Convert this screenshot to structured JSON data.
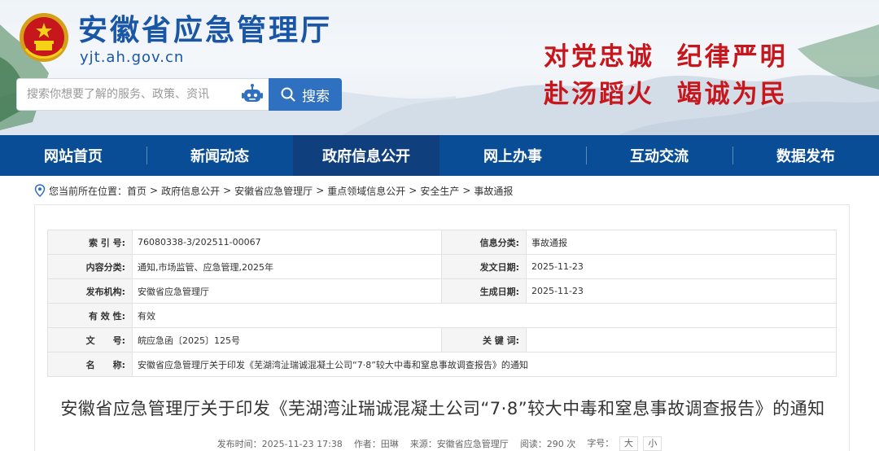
{
  "header": {
    "site_title": "安徽省应急管理厅",
    "site_domain": "yjt.ah.gov.cn",
    "slogan_line1": "对党忠诚  纪律严明",
    "slogan_line2": "赴汤蹈火  竭诚为民",
    "search": {
      "placeholder": "搜索你想要了解的服务、政策、资讯",
      "button_label": "搜索"
    }
  },
  "nav": {
    "items": [
      {
        "label": "网站首页"
      },
      {
        "label": "新闻动态"
      },
      {
        "label": "政府信息公开"
      },
      {
        "label": "网上办事"
      },
      {
        "label": "互动交流"
      },
      {
        "label": "数据发布"
      }
    ],
    "active_index": 2
  },
  "breadcrumb": {
    "prefix": "您当前所在位置：",
    "items": [
      "首页",
      "政府信息公开",
      "安徽省应急管理厅",
      "重点领域信息公开",
      "安全生产",
      "事故通报"
    ],
    "separator": ">"
  },
  "meta": {
    "index_label": "索 引 号:",
    "index_value": "76080338-3/202511-00067",
    "category_label": "信息分类:",
    "category_value": "事故通报",
    "content_class_label": "内容分类:",
    "content_class_value": "通知,市场监管、应急管理,2025年",
    "issue_date_label": "发文日期:",
    "issue_date_value": "2025-11-23",
    "publisher_label": "发布机构:",
    "publisher_value": "安徽省应急管理厅",
    "effective_date_label": "生成日期:",
    "effective_date_value": "2025-11-23",
    "validity_label": "有 效 性:",
    "validity_value": "有效",
    "doc_no_label": "文　　号:",
    "doc_no_value": "皖应急函〔2025〕125号",
    "keywords_label": "关 键 词:",
    "keywords_value": "",
    "name_label": "名　　称:",
    "name_value": "安徽省应急管理厅关于印发《芜湖湾沚瑞诚混凝土公司“7·8”较大中毒和窒息事故调查报告》的通知"
  },
  "article": {
    "title": "安徽省应急管理厅关于印发《芜湖湾沚瑞诚混凝土公司“7·8”较大中毒和窒息事故调查报告》的通知",
    "publish_time": "发布时间：2025-11-23 17:38",
    "author": "作者：田琳",
    "source": "来源：安徽省应急管理厅",
    "views": "阅读：290 次",
    "font_size_label": "字号：",
    "font_large": "大",
    "font_small": "小"
  },
  "colors": {
    "brand_blue": "#1a56a6",
    "nav_blue": "#0a4d97",
    "nav_active": "#0f3f7d",
    "slogan_red": "#c8161d"
  },
  "icons": {
    "emblem": "national-emblem-icon",
    "robot": "robot-assistant-icon",
    "search": "search-icon",
    "location": "location-pin-icon"
  }
}
